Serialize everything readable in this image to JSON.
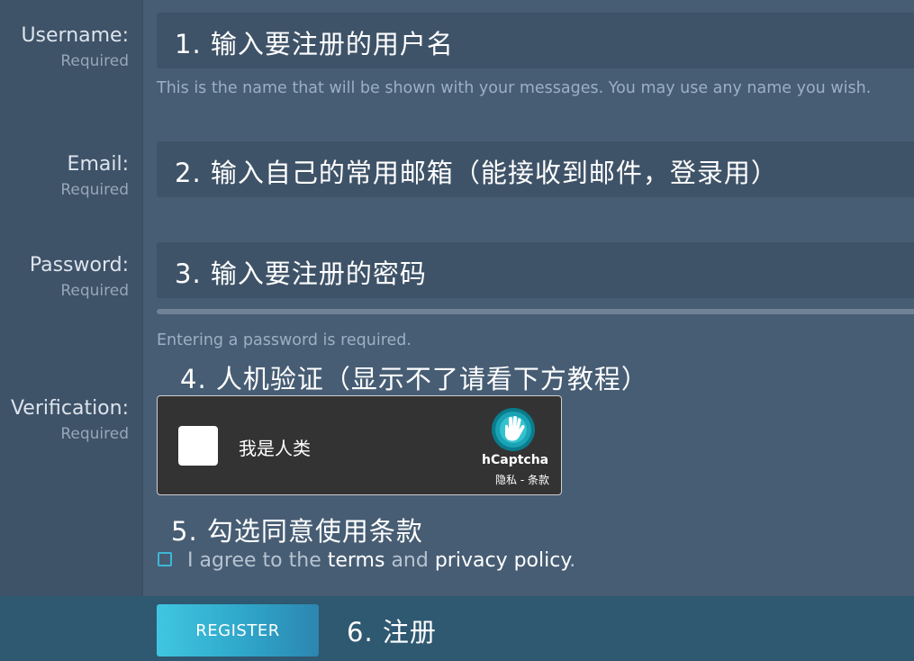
{
  "fields": {
    "username": {
      "label": "Username:",
      "hint": "Required",
      "value": "1. 输入要注册的用户名",
      "help": "This is the name that will be shown with your messages. You may use any name you wish."
    },
    "email": {
      "label": "Email:",
      "hint": "Required",
      "value": "2. 输入自己的常用邮箱（能接收到邮件，登录用）"
    },
    "password": {
      "label": "Password:",
      "hint": "Required",
      "value": "3. 输入要注册的密码",
      "help": "Entering a password is required."
    },
    "verification": {
      "label": "Verification:",
      "hint": "Required"
    }
  },
  "annotations": {
    "verify": "4. 人机验证（显示不了请看下方教程）",
    "agree": "5. 勾选同意使用条款",
    "register": "6. 注册"
  },
  "captcha": {
    "checkbox_label": "我是人类",
    "brand": "hCaptcha",
    "links": "隐私 - 条款",
    "logo_icon": "hcaptcha-hand-logo-icon"
  },
  "agree": {
    "prefix": "I agree to the ",
    "terms": "terms",
    "middle": " and ",
    "privacy": "privacy policy",
    "suffix": "."
  },
  "register_button": "REGISTER",
  "colors": {
    "background": "#475d74",
    "label_column": "#3e5268",
    "input": "#3f5368",
    "footer": "#2f5871",
    "accent": "#3fc7e0"
  }
}
